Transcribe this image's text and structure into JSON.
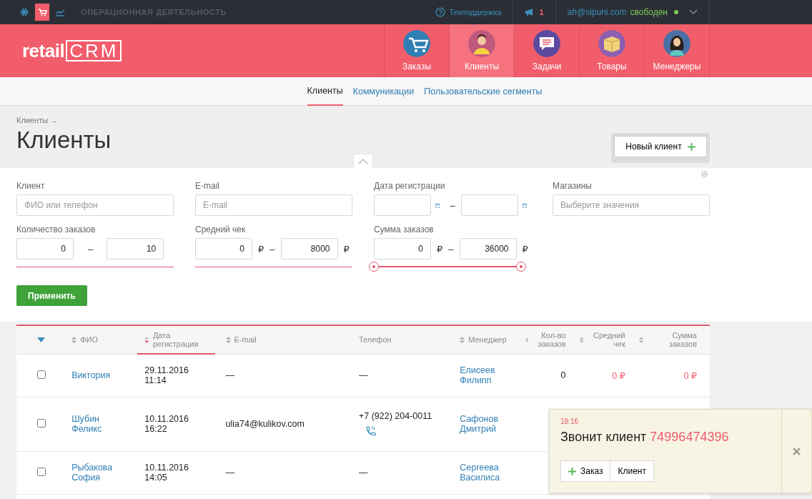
{
  "top_bar": {
    "icons": [
      {
        "kind": "settings",
        "selected": false
      },
      {
        "kind": "cart",
        "selected": true
      },
      {
        "kind": "chart",
        "selected": false
      }
    ],
    "section": "ОПЕРАЦИОННАЯ ДЕЯТЕЛЬНОСТЬ",
    "support": "Техподдержка",
    "notifications": "1",
    "user_email": "ah@sipuni.com",
    "user_status": "свободен",
    "online": true
  },
  "header": {
    "logo": {
      "text": "retail",
      "mark": "CRM"
    },
    "nav": [
      {
        "label": "Заказы",
        "kind": "cart",
        "selected": false
      },
      {
        "label": "Клиенты",
        "kind": "person",
        "selected": true
      },
      {
        "label": "Задачи",
        "kind": "chat",
        "selected": false
      },
      {
        "label": "Товары",
        "kind": "box",
        "selected": false
      },
      {
        "label": "Менеджеры",
        "kind": "manager",
        "selected": false
      }
    ]
  },
  "subnav": [
    {
      "label": "Клиенты",
      "selected": true
    },
    {
      "label": "Коммуникации",
      "selected": false
    },
    {
      "label": "Пользовательские сегменты",
      "selected": false
    }
  ],
  "page": {
    "breadcrumb": "Клиенты →",
    "title": "Клиенты",
    "new_button": "Новый клиент"
  },
  "filters": [
    {
      "kind": "text",
      "label": "Клиент",
      "placeholder": "ФИО или телефон"
    },
    {
      "kind": "text",
      "label": "E-mail",
      "placeholder": "E-mail"
    },
    {
      "kind": "date_range",
      "label": "Дата регистрации",
      "separator": "–"
    },
    {
      "kind": "select",
      "label": "Магазины",
      "placeholder": "Выберите значения"
    },
    {
      "kind": "range",
      "label": "Количество заказов",
      "from": "0",
      "to": "10",
      "separator": "–",
      "slider": false
    },
    {
      "kind": "range",
      "label": "Средний чек",
      "from": "0",
      "to": "8000",
      "separator": "–",
      "currency": "₽",
      "slider": false
    },
    {
      "kind": "range",
      "label": "Сумма заказов",
      "from": "0",
      "to": "36000",
      "separator": "–",
      "currency": "₽",
      "slider": true,
      "level": 1
    }
  ],
  "apply_button": "Применить",
  "table": {
    "columns": [
      {
        "label": "ФИО",
        "sorted": false
      },
      {
        "label": "Дата регистрации",
        "sorted": true
      },
      {
        "label": "E-mail",
        "sorted": false
      },
      {
        "label": "Телефон",
        "sortable": false,
        "sorted": false
      },
      {
        "label": "Менеджер",
        "sorted": false
      },
      {
        "label": "Кол-во заказов",
        "sorted": false
      },
      {
        "label": "Средний чек",
        "sorted": false
      },
      {
        "label": "Сумма заказов",
        "sorted": false
      }
    ],
    "rows": [
      {
        "checked": false,
        "name": "Виктория",
        "date": "29.11.2016 11:14",
        "email": "—",
        "phone": "—",
        "call": false,
        "manager": "Елисеев Филипп",
        "count": "0",
        "avg": "0 ₽",
        "sum": "0 ₽"
      },
      {
        "checked": false,
        "name": "Шубин Феликс",
        "date": "10.11.2016 16:22",
        "email": "ulia74@kulikov.com",
        "phone": "+7 (922) 204-0011",
        "call": true,
        "manager": "Сафонов Дмитрий"
      },
      {
        "checked": false,
        "name": "Рыбакова София",
        "date": "10.11.2016 14:05",
        "email": "—",
        "phone": "—",
        "call": false,
        "manager": "Сергеева Василиса"
      }
    ]
  },
  "call_popup": {
    "time": "18:16",
    "text": "Звонит клиент",
    "number": "74996474396",
    "buttons": [
      "Заказ",
      "Клиент"
    ]
  }
}
